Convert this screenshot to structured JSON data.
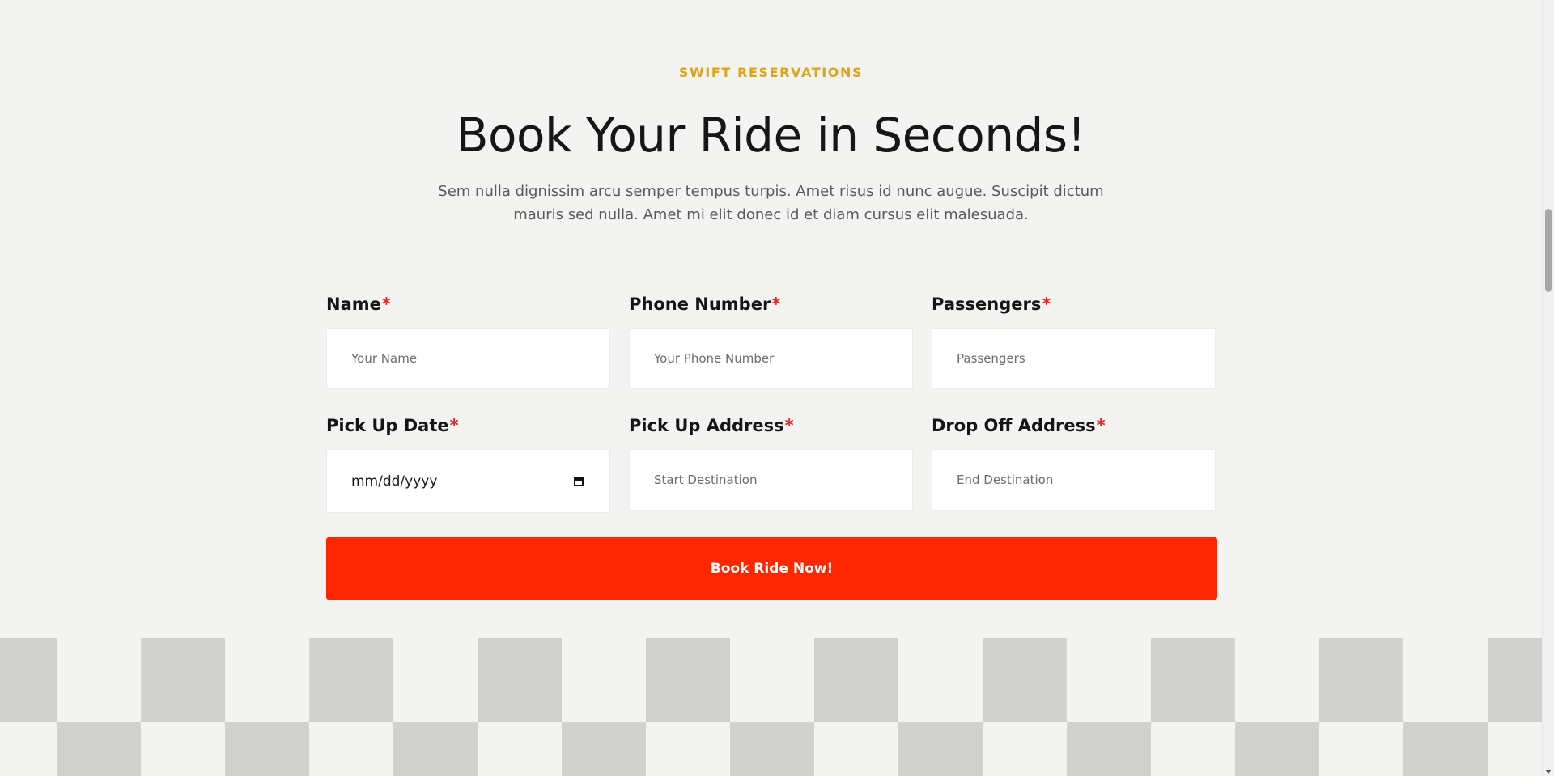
{
  "section": {
    "eyebrow": "SWIFT RESERVATIONS",
    "title": "Book Your Ride in Seconds!",
    "description": "Sem nulla dignissim arcu semper tempus turpis. Amet risus id nunc augue. Suscipit dictum mauris sed nulla. Amet mi elit donec id et diam cursus elit malesuada."
  },
  "form": {
    "required_marker": "*",
    "fields": [
      {
        "label": "Name",
        "placeholder": "Your Name"
      },
      {
        "label": "Phone Number",
        "placeholder": "Your Phone Number"
      },
      {
        "label": "Passengers",
        "placeholder": "Passengers"
      },
      {
        "label": "Pick Up Date",
        "placeholder": "mm/dd/yyyy"
      },
      {
        "label": "Pick Up Address",
        "placeholder": "Start Destination"
      },
      {
        "label": "Drop Off Address",
        "placeholder": "End Destination"
      }
    ],
    "submit_label": "Book Ride Now!"
  },
  "icons": {
    "date_picker": "calendar-icon",
    "scroll_down": "scroll-down-arrow-icon"
  },
  "colors": {
    "accent": "#d9a51a",
    "button": "#ff2600",
    "required": "#e8251c",
    "background": "#f3f3f1",
    "checker": "#d1d1cf"
  }
}
